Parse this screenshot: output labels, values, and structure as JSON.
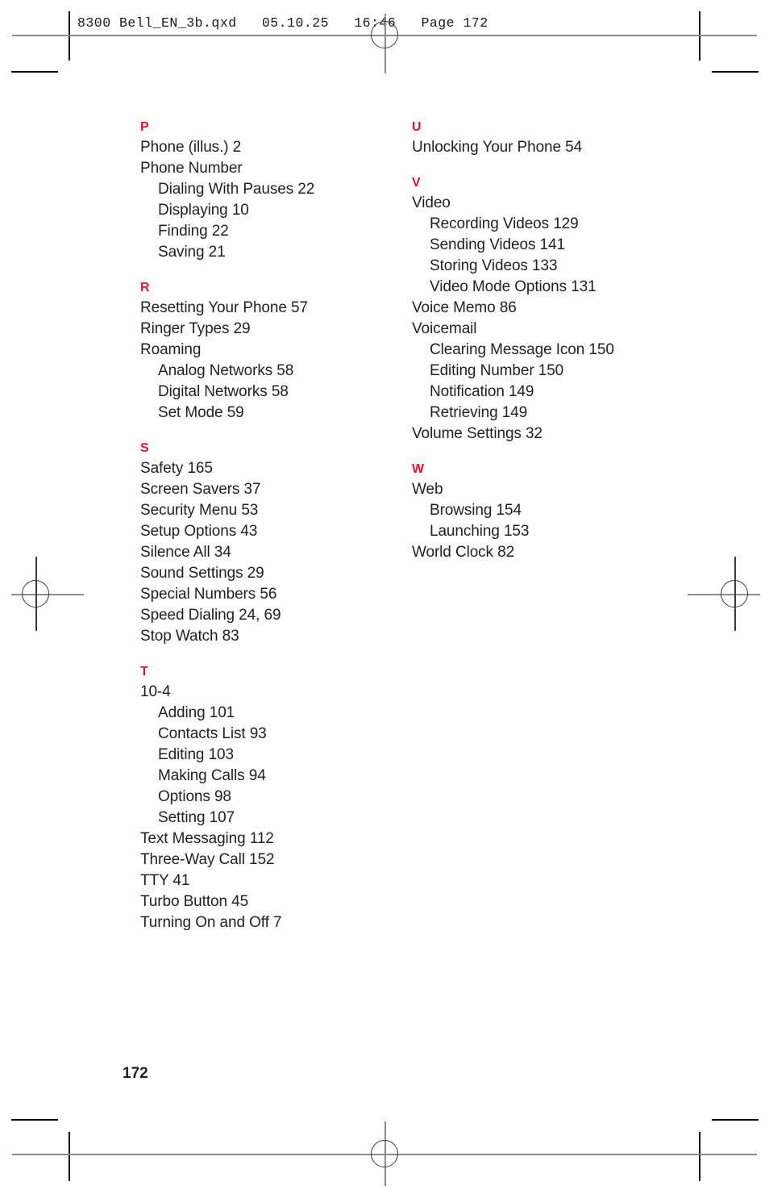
{
  "document": {
    "slug_line": "8300 Bell_EN_3b.qxd   05.10.25   16:46   Page 172",
    "folio": "172",
    "accent_color": "#e8112d",
    "text_color": "#231f20"
  },
  "index": {
    "left_column": [
      {
        "letter": "P",
        "entries": [
          {
            "text": "Phone (illus.) 2",
            "level": 0
          },
          {
            "text": "Phone Number",
            "level": 0
          },
          {
            "text": "Dialing With Pauses 22",
            "level": 1
          },
          {
            "text": "Displaying 10",
            "level": 1
          },
          {
            "text": "Finding 22",
            "level": 1
          },
          {
            "text": "Saving 21",
            "level": 1
          }
        ]
      },
      {
        "letter": "R",
        "entries": [
          {
            "text": "Resetting Your Phone 57",
            "level": 0
          },
          {
            "text": "Ringer Types 29",
            "level": 0
          },
          {
            "text": "Roaming",
            "level": 0
          },
          {
            "text": "Analog Networks 58",
            "level": 1
          },
          {
            "text": "Digital Networks 58",
            "level": 1
          },
          {
            "text": "Set Mode 59",
            "level": 1
          }
        ]
      },
      {
        "letter": "S",
        "entries": [
          {
            "text": "Safety 165",
            "level": 0
          },
          {
            "text": "Screen Savers 37",
            "level": 0
          },
          {
            "text": "Security Menu 53",
            "level": 0
          },
          {
            "text": "Setup Options 43",
            "level": 0
          },
          {
            "text": "Silence All 34",
            "level": 0
          },
          {
            "text": "Sound Settings 29",
            "level": 0
          },
          {
            "text": "Special Numbers 56",
            "level": 0
          },
          {
            "text": "Speed Dialing 24, 69",
            "level": 0
          },
          {
            "text": "Stop Watch 83",
            "level": 0
          }
        ]
      },
      {
        "letter": "T",
        "entries": [
          {
            "text": "10-4",
            "level": 0
          },
          {
            "text": "Adding 101",
            "level": 1
          },
          {
            "text": "Contacts List 93",
            "level": 1
          },
          {
            "text": "Editing 103",
            "level": 1
          },
          {
            "text": "Making Calls 94",
            "level": 1
          },
          {
            "text": "Options 98",
            "level": 1
          },
          {
            "text": "Setting 107",
            "level": 1
          },
          {
            "text": "Text Messaging 112",
            "level": 0
          },
          {
            "text": "Three-Way Call 152",
            "level": 0
          },
          {
            "text": "TTY 41",
            "level": 0
          },
          {
            "text": "Turbo Button 45",
            "level": 0
          },
          {
            "text": "Turning On and Off 7",
            "level": 0
          }
        ]
      }
    ],
    "right_column": [
      {
        "letter": "U",
        "entries": [
          {
            "text": "Unlocking Your Phone 54",
            "level": 0
          }
        ]
      },
      {
        "letter": "V",
        "entries": [
          {
            "text": "Video",
            "level": 0
          },
          {
            "text": "Recording Videos 129",
            "level": 1
          },
          {
            "text": "Sending Videos 141",
            "level": 1
          },
          {
            "text": "Storing Videos 133",
            "level": 1
          },
          {
            "text": "Video Mode Options 131",
            "level": 1
          },
          {
            "text": "Voice Memo 86",
            "level": 0
          },
          {
            "text": "Voicemail",
            "level": 0
          },
          {
            "text": "Clearing Message Icon 150",
            "level": 1
          },
          {
            "text": "Editing Number 150",
            "level": 1
          },
          {
            "text": "Notification 149",
            "level": 1
          },
          {
            "text": "Retrieving 149",
            "level": 1
          },
          {
            "text": "Volume Settings 32",
            "level": 0
          }
        ]
      },
      {
        "letter": "W",
        "entries": [
          {
            "text": "Web",
            "level": 0
          },
          {
            "text": "Browsing 154",
            "level": 1
          },
          {
            "text": "Launching 153",
            "level": 1
          },
          {
            "text": "World Clock 82",
            "level": 0
          }
        ]
      }
    ]
  },
  "print_marks": {
    "crop_mark_label": "crop-mark",
    "registration_mark_label": "registration-mark"
  }
}
